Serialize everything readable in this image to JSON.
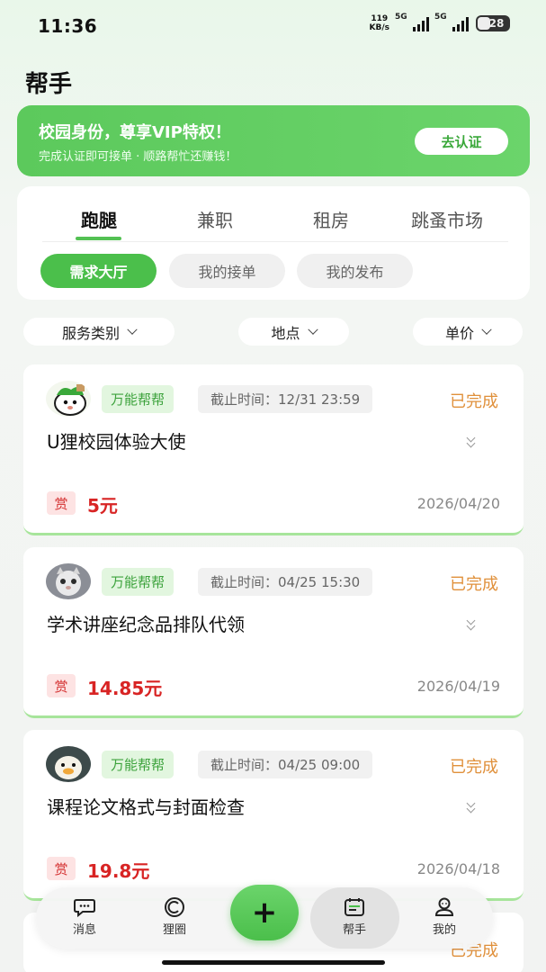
{
  "status_bar": {
    "time": "11:36",
    "speed_value": "119",
    "speed_unit": "KB/s",
    "signal1": "5G",
    "signal2": "5G",
    "battery": "28"
  },
  "page": {
    "title": "帮手"
  },
  "vip": {
    "title": "校园身份，尊享VIP特权！",
    "subtitle": "完成认证即可接单 · 顺路帮忙还赚钱！",
    "button": "去认证"
  },
  "tabs": [
    "跑腿",
    "兼职",
    "租房",
    "跳蚤市场"
  ],
  "chips": [
    "需求大厅",
    "我的接单",
    "我的发布"
  ],
  "filters": [
    "服务类别",
    "地点",
    "单价"
  ],
  "cards": [
    {
      "tag": "万能帮帮",
      "deadline": "截止时间：12/31 23:59",
      "status": "已完成",
      "title": "U狸校园体验大使",
      "reward_label": "赏",
      "reward": "5元",
      "date": "2026/04/20"
    },
    {
      "tag": "万能帮帮",
      "deadline": "截止时间：04/25 15:30",
      "status": "已完成",
      "title": "学术讲座纪念品排队代领",
      "reward_label": "赏",
      "reward": "14.85元",
      "date": "2026/04/19"
    },
    {
      "tag": "万能帮帮",
      "deadline": "截止时间：04/25 09:00",
      "status": "已完成",
      "title": "课程论文格式与封面检查",
      "reward_label": "赏",
      "reward": "19.8元",
      "date": "2026/04/18"
    }
  ],
  "peek": {
    "status": "已完成"
  },
  "nav": {
    "items": [
      "消息",
      "狸圈",
      "帮手",
      "我的"
    ],
    "fab": "+",
    "active": "帮手"
  },
  "colors": {
    "accent": "#4bbf4b",
    "status": "#e0903b",
    "reward": "#d82424"
  }
}
